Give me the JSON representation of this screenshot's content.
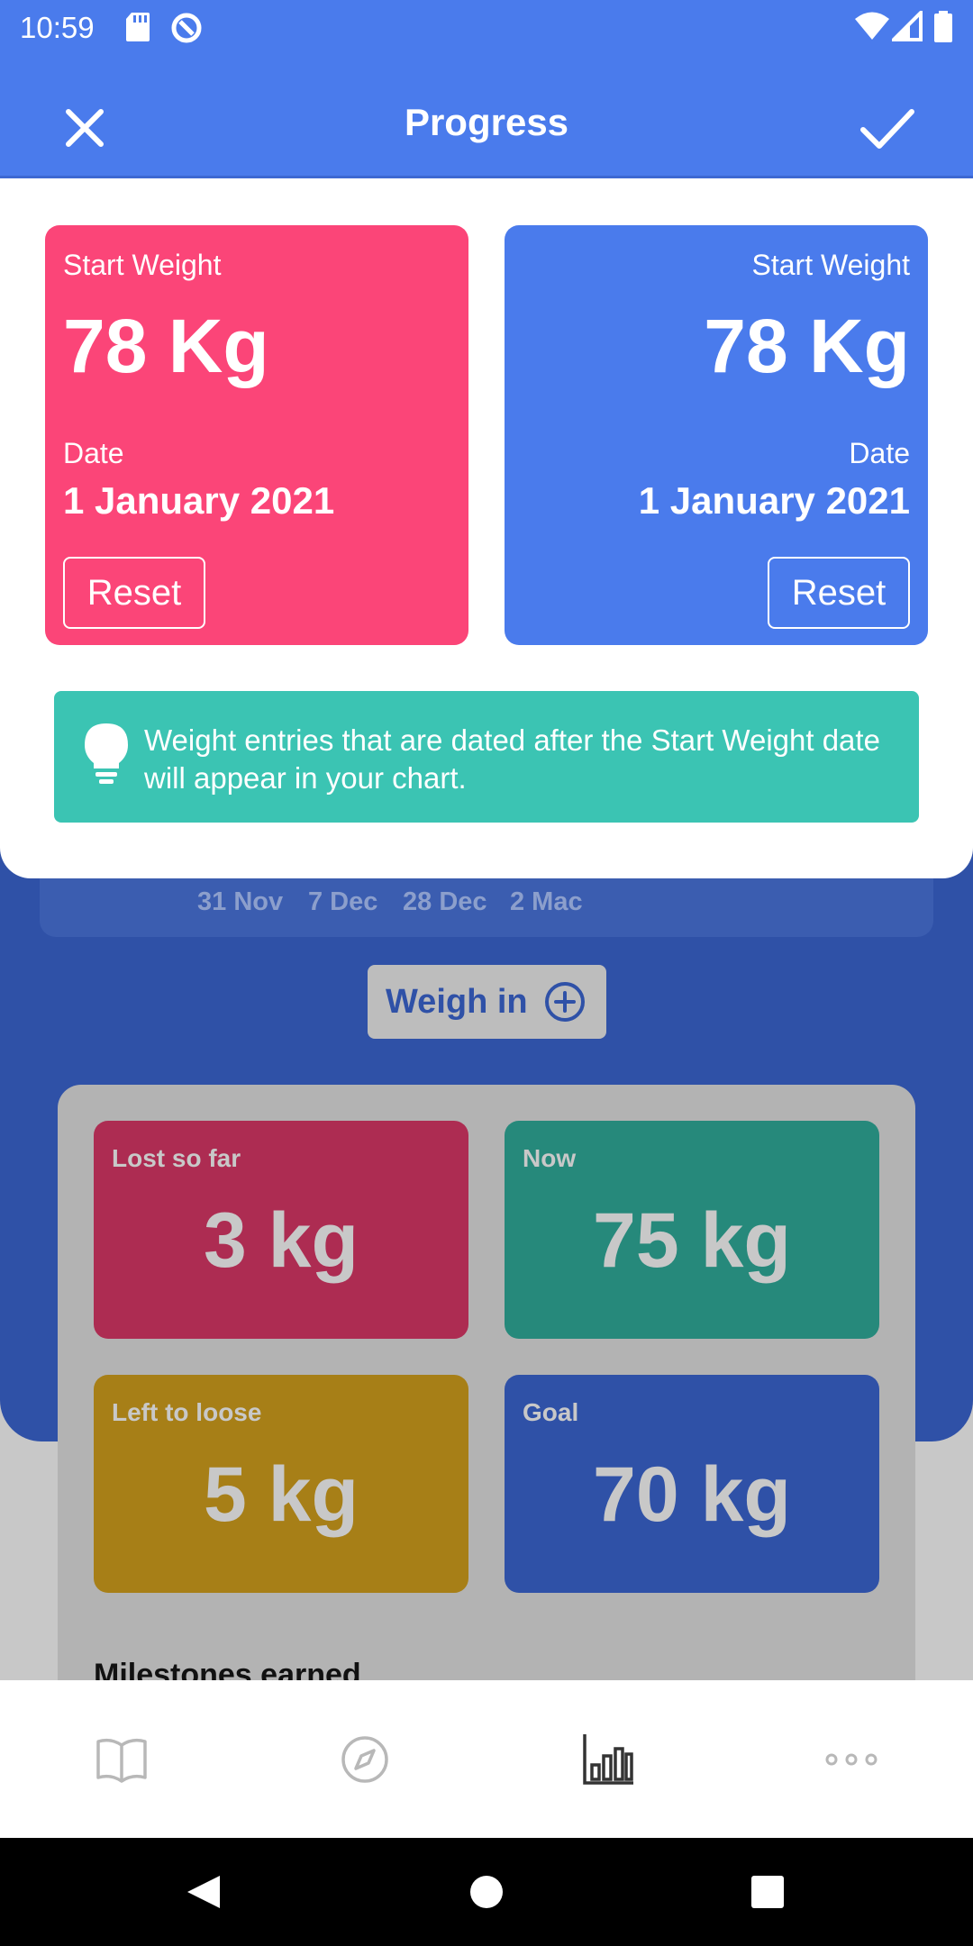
{
  "status_bar": {
    "time": "10:59"
  },
  "app_bar": {
    "title": "Progress"
  },
  "start_cards": [
    {
      "label": "Start Weight",
      "value": "78 Kg",
      "date_label": "Date",
      "date": "1 January 2021",
      "button": "Reset",
      "color": "#fb4578"
    },
    {
      "label": "Start Weight",
      "value": "78 Kg",
      "date_label": "Date",
      "date": "1 January 2021",
      "button": "Reset",
      "color": "#4a7bec"
    }
  ],
  "tip": {
    "text": "Weight entries that are dated after the Start Weight date will appear in your chart.",
    "color": "#3bc4b3"
  },
  "background": {
    "chart_xaxis": [
      "31 Nov",
      "7 Dec",
      "28 Dec",
      "2 Mac"
    ],
    "weigh_in_label": "Weigh in",
    "stats": [
      {
        "label": "Lost so far",
        "value": "3 kg",
        "color": "#ad2c52"
      },
      {
        "label": "Now",
        "value": "75 kg",
        "color": "#26897b"
      },
      {
        "label": "Left to loose",
        "value": "5 kg",
        "color": "#a77f17"
      },
      {
        "label": "Goal",
        "value": "70 kg",
        "color": "#2f51a7"
      }
    ],
    "milestones_title": "Milestones earned"
  },
  "bottom_nav": [
    {
      "name": "journal",
      "icon": "book-icon"
    },
    {
      "name": "explore",
      "icon": "compass-icon"
    },
    {
      "name": "progress",
      "icon": "bar-chart-icon",
      "active": true
    },
    {
      "name": "more",
      "icon": "more-horizontal-icon"
    }
  ]
}
